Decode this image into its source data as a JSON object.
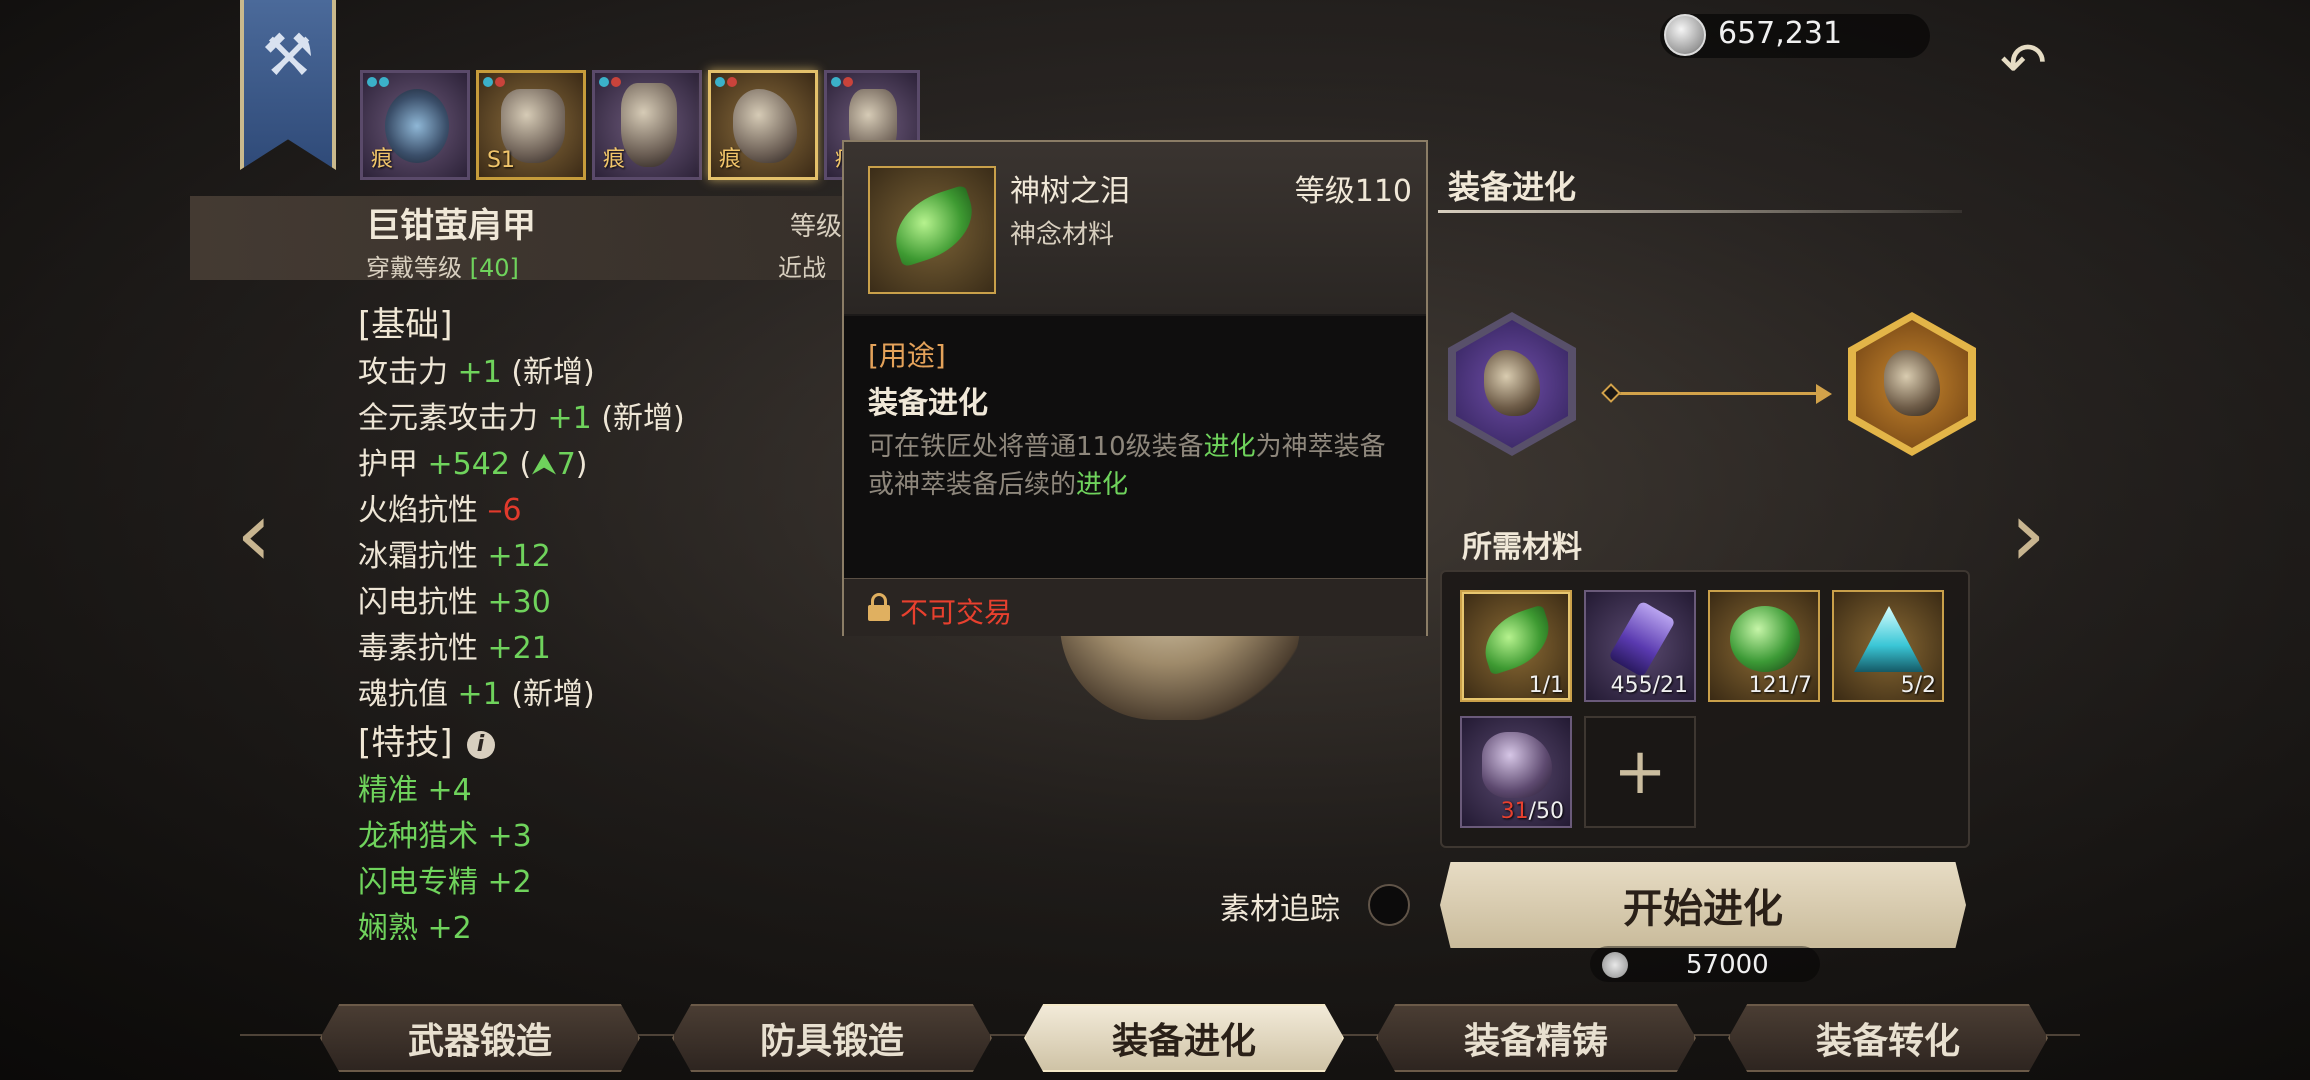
{
  "currency": {
    "amount": "657,231",
    "icon": "silver-coin-icon"
  },
  "equipment_slots": [
    {
      "tag": "痕",
      "frame": "purple"
    },
    {
      "tag": "S1",
      "frame": "gold"
    },
    {
      "tag": "痕",
      "frame": "purple"
    },
    {
      "tag": "痕",
      "frame": "gold",
      "selected": true
    },
    {
      "tag": "痕",
      "frame": "purple"
    }
  ],
  "item": {
    "name": "巨钳萤肩甲",
    "level_label": "等级",
    "wear_label": "穿戴等级",
    "wear_value": "[40]",
    "melee_label": "近战"
  },
  "stats": {
    "basic_header": "[基础]",
    "basic": [
      {
        "name": "攻击力 ",
        "value": "+1",
        "extra": " (新增)"
      },
      {
        "name": "全元素攻击力 ",
        "value": "+1",
        "extra": " (新增)"
      },
      {
        "name": "护甲 ",
        "value": "+542",
        "extra": " (",
        "up": "⮝7",
        "close": ")"
      },
      {
        "name": "火焰抗性 ",
        "value": "–6",
        "negative": true
      },
      {
        "name": "冰霜抗性 ",
        "value": "+12"
      },
      {
        "name": "闪电抗性 ",
        "value": "+30"
      },
      {
        "name": "毒素抗性 ",
        "value": "+21"
      },
      {
        "name": "魂抗值 ",
        "value": "+1",
        "extra": " (新增)"
      }
    ],
    "skill_header": "[特技]",
    "skills": [
      "精准 +4",
      "龙种猎术 +3",
      "闪电专精 +2",
      "娴熟 +2"
    ]
  },
  "tooltip": {
    "name": "神树之泪",
    "level": "等级110",
    "type": "神念材料",
    "use_label": "[用途]",
    "use_value": "装备进化",
    "desc_parts": [
      "可在铁匠处将普通110级装备",
      "进化",
      "为神萃装备或神萃装备后续的",
      "进化"
    ],
    "trade": "不可交易"
  },
  "evolution": {
    "title": "装备进化",
    "materials_title": "所需材料",
    "materials": [
      {
        "name": "tear-of-divine-tree",
        "count": "1/1",
        "frame": "gold"
      },
      {
        "name": "purple-crystal",
        "count": "455/21",
        "frame": "purple"
      },
      {
        "name": "green-orb",
        "count": "121/7",
        "frame": "gold"
      },
      {
        "name": "cyan-shard",
        "count": "5/2",
        "frame": "gold"
      },
      {
        "name": "dark-ore",
        "have": "31",
        "need": "/50",
        "frame": "purple"
      }
    ],
    "track_label": "素材追踪",
    "start_label": "开始进化",
    "cost": "57000"
  },
  "tabs": [
    {
      "label": "武器锻造"
    },
    {
      "label": "防具锻造"
    },
    {
      "label": "装备进化",
      "active": true
    },
    {
      "label": "装备精铸"
    },
    {
      "label": "装备转化"
    }
  ],
  "colors": {
    "positive": "#6fd35c",
    "negative": "#e23a2c",
    "accent_gold": "#d2a24a",
    "use_label": "#e4a25a"
  }
}
